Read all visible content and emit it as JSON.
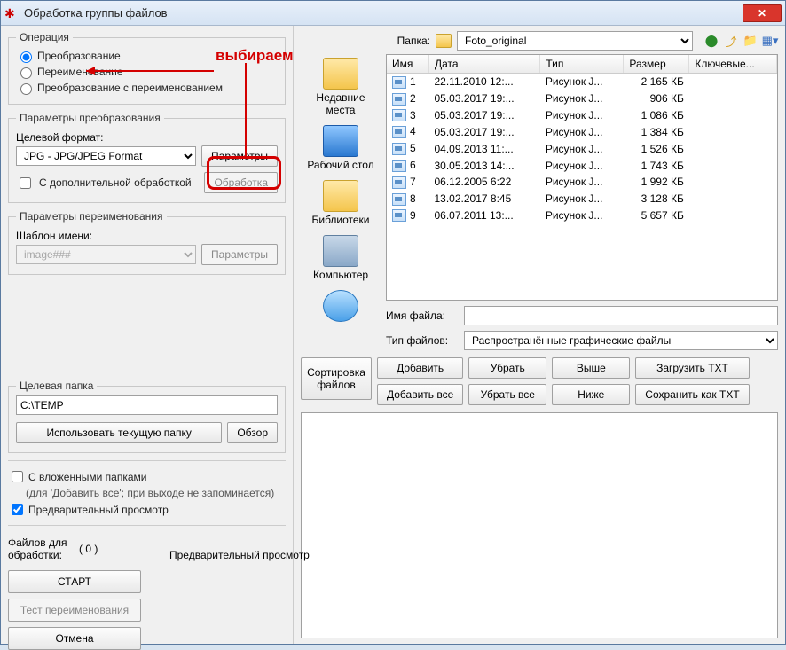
{
  "window": {
    "title": "Обработка группы файлов"
  },
  "annotation": {
    "text": "выбираем"
  },
  "operation": {
    "legend": "Операция",
    "r1": "Преобразование",
    "r2": "Переименование",
    "r3": "Преобразование с переименованием"
  },
  "transform": {
    "legend": "Параметры преобразования",
    "target_label": "Целевой формат:",
    "format": "JPG - JPG/JPEG Format",
    "params_btn": "Параметры",
    "extra_check": "С дополнительной обработкой",
    "extra_btn": "Обработка"
  },
  "rename": {
    "legend": "Параметры переименования",
    "template_label": "Шаблон имени:",
    "template_value": "image###",
    "params_btn": "Параметры"
  },
  "target_folder": {
    "legend": "Целевая папка",
    "value": "C:\\TEMP",
    "use_current": "Использовать текущую папку",
    "browse": "Обзор"
  },
  "subfolders": {
    "check": "С вложенными папками",
    "hint": "(для 'Добавить все'; при выходе не запоминается)"
  },
  "preview_check": "Предварительный просмотр",
  "files_for": {
    "label": "Файлов для обработки:",
    "count": "( 0 )"
  },
  "start": "СТАРТ",
  "test_rename": "Тест переименования",
  "cancel": "Отмена",
  "preview_label": "Предварительный просмотр",
  "folder_row": {
    "label": "Папка:",
    "value": "Foto_original"
  },
  "places": {
    "recent": "Недавние места",
    "desktop": "Рабочий стол",
    "libraries": "Библиотеки",
    "computer": "Компьютер"
  },
  "cols": {
    "name": "Имя",
    "date": "Дата",
    "type": "Тип",
    "size": "Размер",
    "keywords": "Ключевые..."
  },
  "files": [
    {
      "n": "1",
      "d": "22.11.2010 12:...",
      "t": "Рисунок J...",
      "s": "2 165 КБ"
    },
    {
      "n": "2",
      "d": "05.03.2017 19:...",
      "t": "Рисунок J...",
      "s": "906 КБ"
    },
    {
      "n": "3",
      "d": "05.03.2017 19:...",
      "t": "Рисунок J...",
      "s": "1 086 КБ"
    },
    {
      "n": "4",
      "d": "05.03.2017 19:...",
      "t": "Рисунок J...",
      "s": "1 384 КБ"
    },
    {
      "n": "5",
      "d": "04.09.2013 11:...",
      "t": "Рисунок J...",
      "s": "1 526 КБ"
    },
    {
      "n": "6",
      "d": "30.05.2013 14:...",
      "t": "Рисунок J...",
      "s": "1 743 КБ"
    },
    {
      "n": "7",
      "d": "06.12.2005 6:22",
      "t": "Рисунок J...",
      "s": "1 992 КБ"
    },
    {
      "n": "8",
      "d": "13.02.2017 8:45",
      "t": "Рисунок J...",
      "s": "3 128 КБ"
    },
    {
      "n": "9",
      "d": "06.07.2011 13:...",
      "t": "Рисунок J...",
      "s": "5 657 КБ"
    }
  ],
  "filename_label": "Имя файла:",
  "filetype_label": "Тип файлов:",
  "filetype_value": "Распространённые графические файлы",
  "sort_btn": "Сортировка файлов",
  "btns": {
    "add": "Добавить",
    "remove": "Убрать",
    "up": "Выше",
    "load": "Загрузить TXT",
    "addall": "Добавить все",
    "removeall": "Убрать все",
    "down": "Ниже",
    "save": "Сохранить как TXT"
  }
}
